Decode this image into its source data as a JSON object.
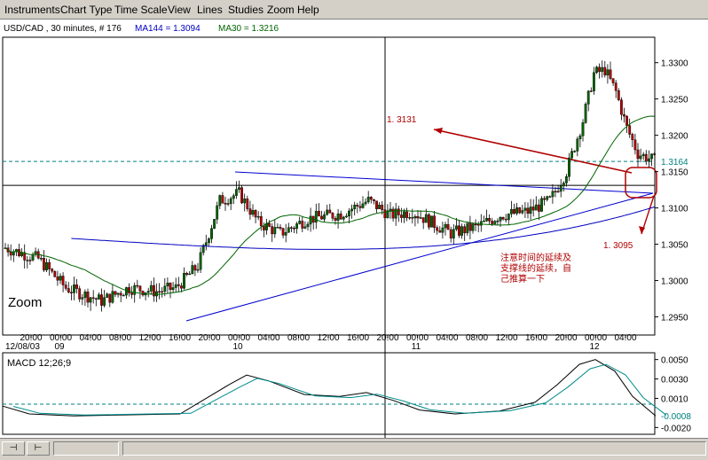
{
  "menu": [
    "Instruments",
    "Chart Type",
    "Time Scale",
    "View",
    "Lines",
    "Studies",
    "Zoom",
    "Help"
  ],
  "header": {
    "symbol_info": "USD/CAD , 30 minutes, # 176",
    "ma144_label": "MA144 = 1.3094",
    "ma30_label": "MA30 = 1.3216"
  },
  "zoom_label": "Zoom",
  "colors": {
    "ma144": "#0000c0",
    "ma30": "#006400",
    "trendline": "#0000d0",
    "annotation": "#b00000",
    "bull_candle": "#006400",
    "bear_candle": "#b00000",
    "dashed_level": "#008080",
    "macd_line": "#000000",
    "signal_line": "#008b8b"
  },
  "crosshair": {
    "price": "1. 3131"
  },
  "annotations": {
    "target_price": "1. 3095",
    "note_lines": [
      "注意时间的延续及",
      "支撑线的延续，自",
      "己推算一下"
    ]
  },
  "chart_data": {
    "type": "candlestick",
    "symbol": "USD/CAD",
    "timeframe": "30 minutes",
    "price_axis": {
      "ticks": [
        "1.3300",
        "1.3250",
        "1.3200",
        "1.3150",
        "1.3100",
        "1.3050",
        "1.3000",
        "1.2950"
      ],
      "highlight_tick": "1.3164",
      "range": [
        1.2925,
        1.3335
      ]
    },
    "time_axis": {
      "ticks": [
        "20:00",
        "00:00",
        "04:00",
        "08:00",
        "12:00",
        "16:00",
        "20:00",
        "00:00",
        "04:00",
        "08:00",
        "12:00",
        "16:00",
        "20:00",
        "00:00",
        "04:00",
        "08:00",
        "12:00",
        "16:00",
        "20:00",
        "00:00",
        "04:00"
      ],
      "date_labels": [
        "12/08/03",
        "09",
        "10",
        "11",
        "12"
      ]
    },
    "horizontal_level": 1.3164,
    "crosshair_level": 1.3131,
    "series": [
      {
        "name": "MA144",
        "value": 1.3094
      },
      {
        "name": "MA30",
        "value": 1.3216
      }
    ],
    "macd": {
      "label": "MACD 12;26;9",
      "ticks": [
        "0.0050",
        "0.0030",
        "0.0010",
        "-0.0020"
      ],
      "highlight_tick": "-0.0008",
      "range": [
        -0.0027,
        0.0057
      ]
    }
  }
}
